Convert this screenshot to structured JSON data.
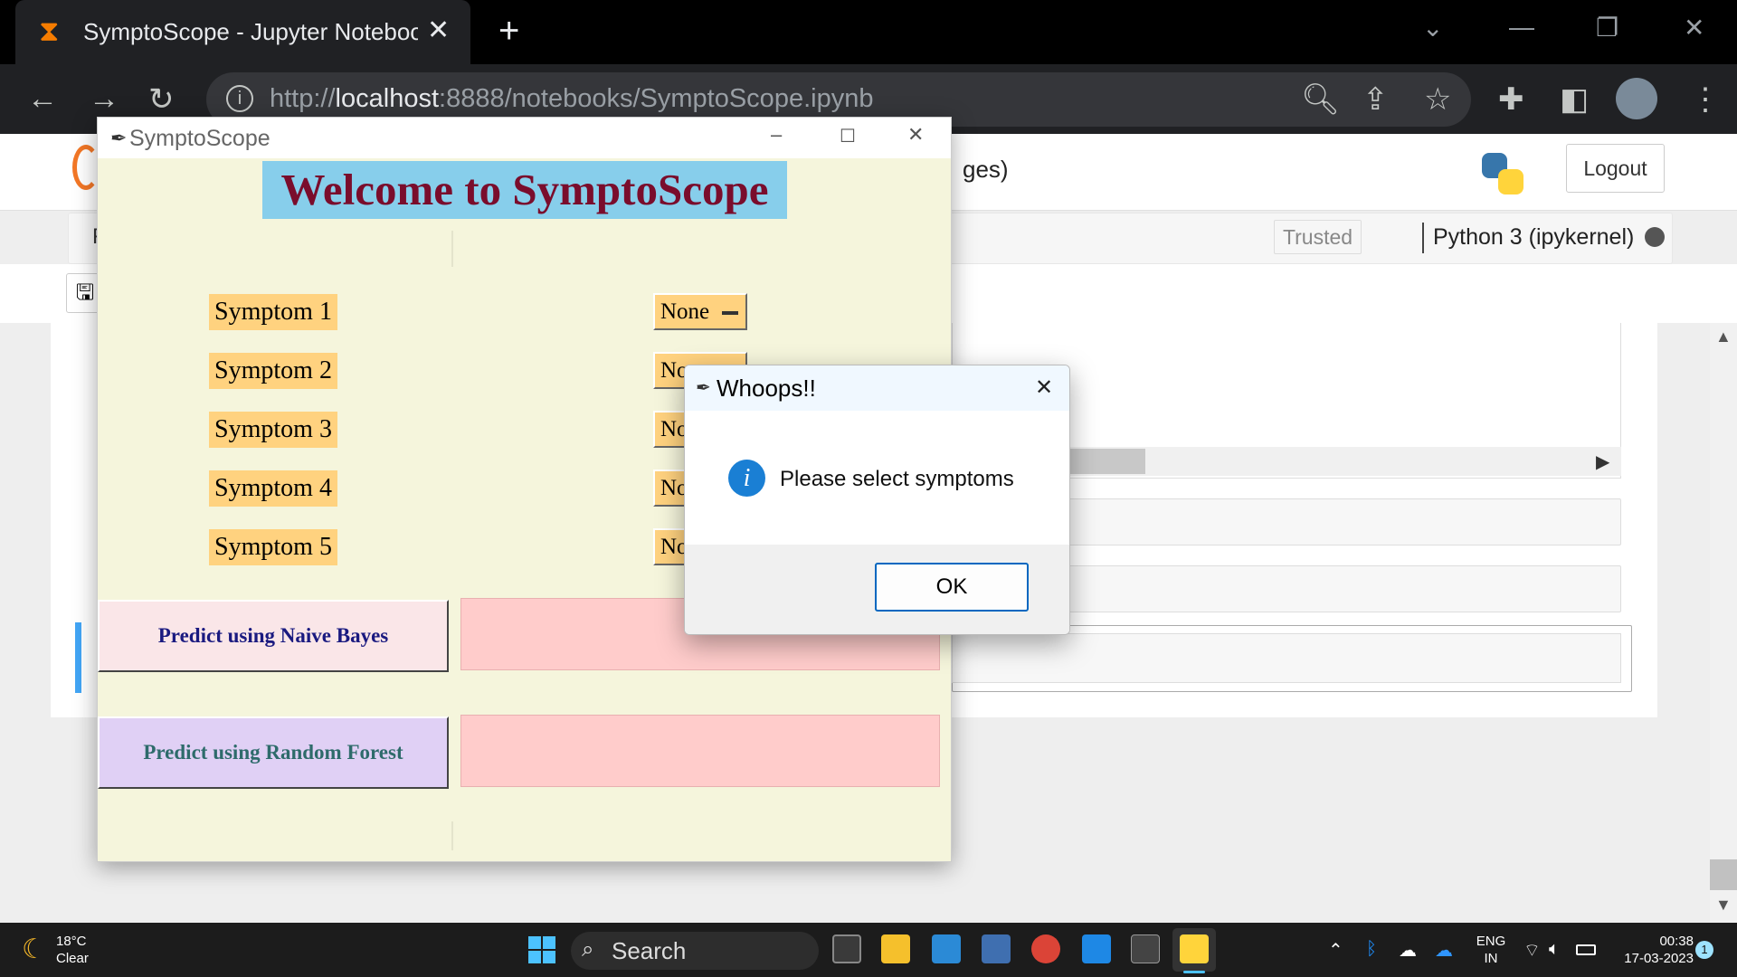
{
  "browser": {
    "tab_title": "SymptoScope - Jupyter Noteboo",
    "url_prefix": "http://",
    "url_host": "localhost",
    "url_rest": ":8888/notebooks/SymptoScope.ipynb"
  },
  "jupyter": {
    "title_fragment": "ges)",
    "logout_label": "Logout",
    "trusted_label": "Trusted",
    "kernel_label": "Python 3 (ipykernel)",
    "menu_fragment": "F"
  },
  "tk_window": {
    "title": "SymptoScope",
    "welcome": "Welcome to SymptoScope",
    "symptoms": [
      "Symptom 1",
      "Symptom 2",
      "Symptom 3",
      "Symptom 4",
      "Symptom 5"
    ],
    "option_values": [
      "None",
      "No",
      "No",
      "No",
      "No"
    ],
    "naive_bayes_label": "Predict using Naive Bayes",
    "random_forest_label": "Predict using Random Forest"
  },
  "dialog": {
    "title": "Whoops!!",
    "message": "Please select symptoms",
    "ok_label": "OK"
  },
  "taskbar": {
    "weather_temp": "18°C",
    "weather_desc": "Clear",
    "search_label": "Search",
    "lang_top": "ENG",
    "lang_bottom": "IN",
    "time": "00:38",
    "date": "17-03-2023",
    "notification_count": "1"
  },
  "colors": {
    "tk_background": "#f5f5dc",
    "welcome_bg": "#87ceeb",
    "welcome_text": "#7a0d2c",
    "symptom_label_bg": "#ffd27f",
    "result_bg": "#ffcccb",
    "naive_bayes_bg": "#fae6e8",
    "random_forest_bg": "#e0d0f5",
    "info_icon": "#1a7fd4"
  }
}
